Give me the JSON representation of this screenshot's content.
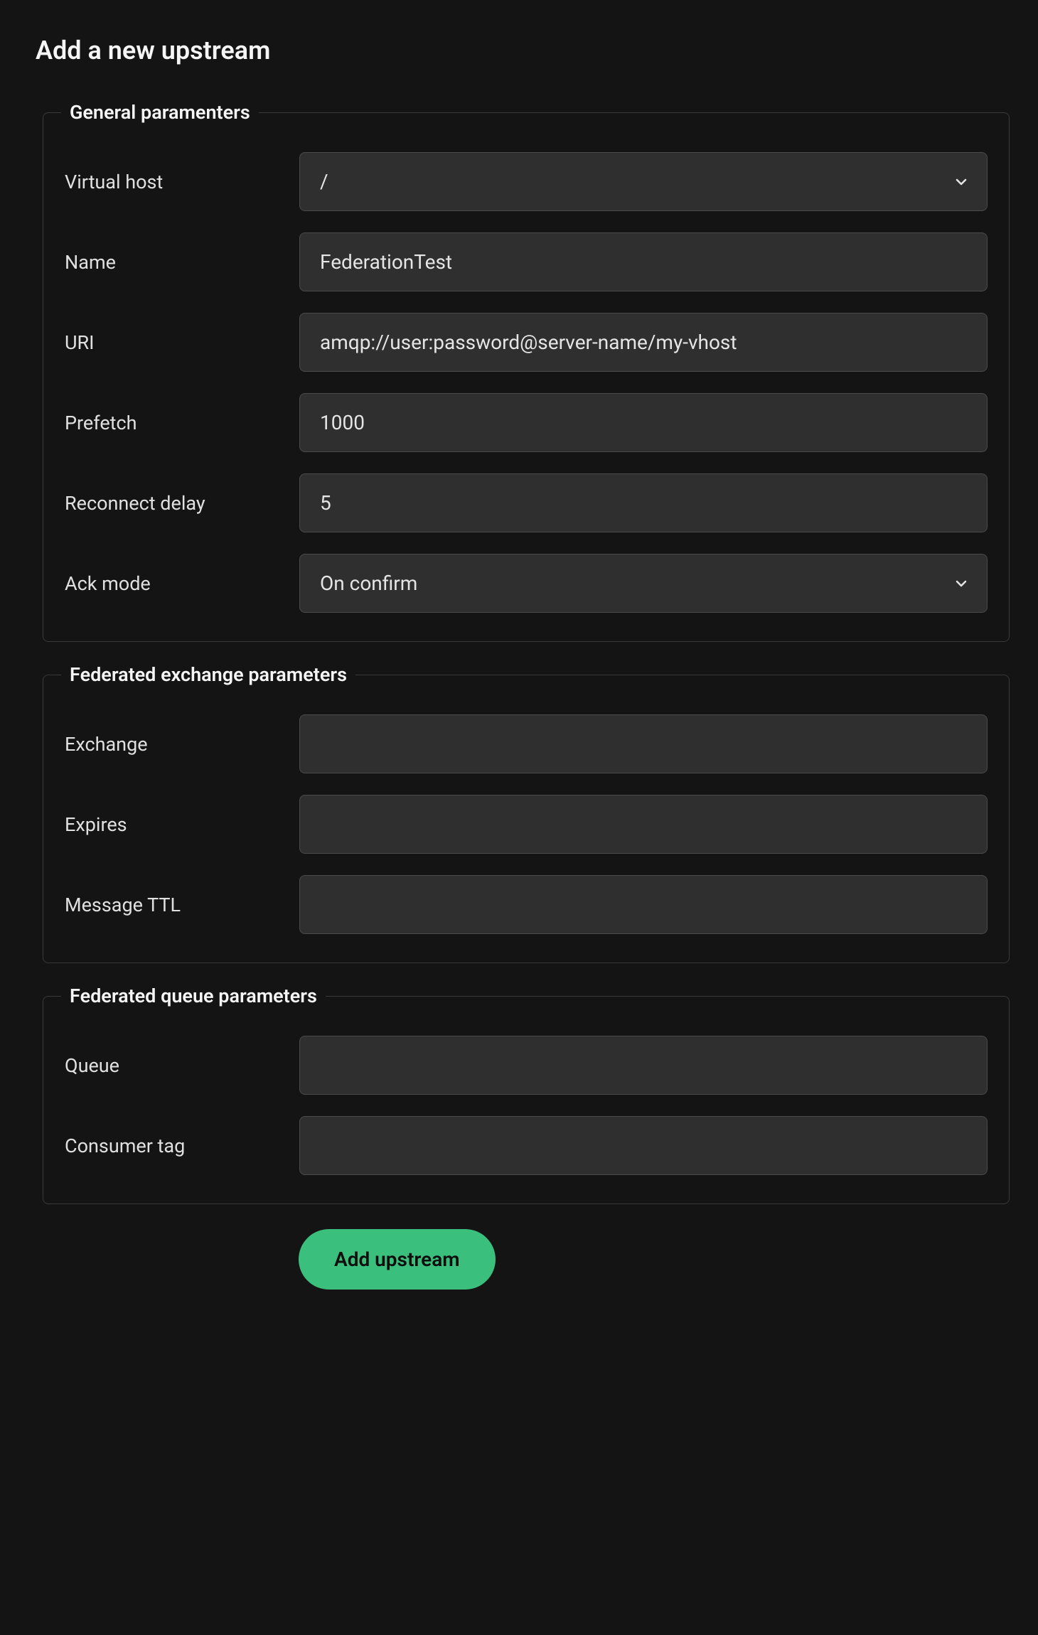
{
  "page": {
    "title": "Add a new upstream"
  },
  "groups": {
    "general": {
      "legend": "General paramenters",
      "vhost": {
        "label": "Virtual host",
        "value": "/"
      },
      "name": {
        "label": "Name",
        "value": "FederationTest"
      },
      "uri": {
        "label": "URI",
        "value": "amqp://user:password@server-name/my-vhost"
      },
      "prefetch": {
        "label": "Prefetch",
        "value": "1000"
      },
      "reconnect_delay": {
        "label": "Reconnect delay",
        "value": "5"
      },
      "ack_mode": {
        "label": "Ack mode",
        "value": "On confirm"
      }
    },
    "exchange": {
      "legend": "Federated exchange parameters",
      "exchange": {
        "label": "Exchange",
        "value": ""
      },
      "expires": {
        "label": "Expires",
        "value": ""
      },
      "message_ttl": {
        "label": "Message TTL",
        "value": ""
      }
    },
    "queue": {
      "legend": "Federated queue parameters",
      "queue": {
        "label": "Queue",
        "value": ""
      },
      "consumer_tag": {
        "label": "Consumer tag",
        "value": ""
      }
    }
  },
  "actions": {
    "submit": "Add upstream"
  }
}
